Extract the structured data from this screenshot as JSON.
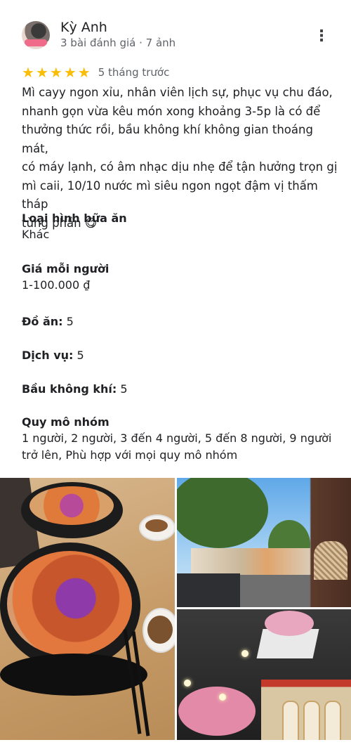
{
  "reviewer": {
    "name": "Kỳ Anh",
    "meta": "3 bài đánh giá · 7 ảnh"
  },
  "rating": {
    "stars": 5,
    "max_stars": 5,
    "date": "5 tháng trước"
  },
  "review_text": "Mì cayy ngon xỉu, nhân viên lịch sự, phục vụ chu đáo,\nnhanh gọn vừa kêu món xong khoảng 3-5p là có để\nthưởng thức rồi, bầu không khí không gian thoáng mát,\ncó máy lạnh, có âm nhạc dịu nhẹ để tận hưởng trọn gị\nmì caii, 10/10 nước mì siêu ngon ngọt đậm vị thấm tháp\ntừng phần 😋",
  "attributes": {
    "meal_type": {
      "label": "Loại hình bữa ăn",
      "value": "Khác"
    },
    "price": {
      "label": "Giá mỗi người",
      "value": "1-100.000 ₫"
    },
    "food": {
      "label": "Đồ ăn:",
      "value": "5"
    },
    "service": {
      "label": "Dịch vụ:",
      "value": "5"
    },
    "atmosphere": {
      "label": "Bầu không khí:",
      "value": "5"
    },
    "group_size": {
      "label": "Quy mô nhóm",
      "value": "1 người, 2 người, 3 đến 4 người, 5 đến 8 người, 9 người trở lên, Phù hợp với mọi quy mô nhóm"
    }
  },
  "colors": {
    "star": "#fbbc04",
    "text": "#202124",
    "secondary": "#5f6368"
  },
  "icons": {
    "more": "more-vert-icon",
    "star": "star-icon"
  }
}
